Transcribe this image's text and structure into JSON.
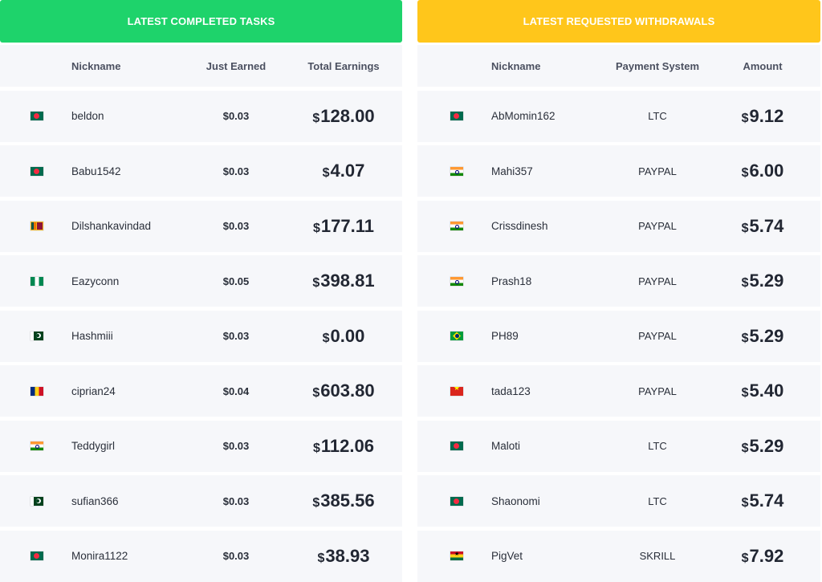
{
  "tasks": {
    "title": "LATEST COMPLETED TASKS",
    "columns": {
      "nickname": "Nickname",
      "just_earned": "Just Earned",
      "total": "Total Earnings"
    },
    "rows": [
      {
        "flag": "bd",
        "nickname": "beldon",
        "just_earned": "$0.03",
        "currency": "$",
        "total": "128.00"
      },
      {
        "flag": "bd",
        "nickname": "Babu1542",
        "just_earned": "$0.03",
        "currency": "$",
        "total": "4.07"
      },
      {
        "flag": "lk",
        "nickname": "Dilshankavindad",
        "just_earned": "$0.03",
        "currency": "$",
        "total": "177.11"
      },
      {
        "flag": "ng",
        "nickname": "Eazyconn",
        "just_earned": "$0.05",
        "currency": "$",
        "total": "398.81"
      },
      {
        "flag": "pk",
        "nickname": "Hashmiii",
        "just_earned": "$0.03",
        "currency": "$",
        "total": "0.00"
      },
      {
        "flag": "ro",
        "nickname": "ciprian24",
        "just_earned": "$0.04",
        "currency": "$",
        "total": "603.80"
      },
      {
        "flag": "in",
        "nickname": "Teddygirl",
        "just_earned": "$0.03",
        "currency": "$",
        "total": "112.06"
      },
      {
        "flag": "pk",
        "nickname": "sufian366",
        "just_earned": "$0.03",
        "currency": "$",
        "total": "385.56"
      },
      {
        "flag": "bd",
        "nickname": "Monira1122",
        "just_earned": "$0.03",
        "currency": "$",
        "total": "38.93"
      }
    ]
  },
  "withdrawals": {
    "title": "LATEST REQUESTED WITHDRAWALS",
    "columns": {
      "nickname": "Nickname",
      "payment_system": "Payment System",
      "amount": "Amount"
    },
    "rows": [
      {
        "flag": "bd",
        "nickname": "AbMomin162",
        "payment_system": "LTC",
        "currency": "$",
        "amount": "9.12"
      },
      {
        "flag": "in",
        "nickname": "Mahi357",
        "payment_system": "PAYPAL",
        "currency": "$",
        "amount": "6.00"
      },
      {
        "flag": "in",
        "nickname": "Crissdinesh",
        "payment_system": "PAYPAL",
        "currency": "$",
        "amount": "5.74"
      },
      {
        "flag": "in",
        "nickname": "Prash18",
        "payment_system": "PAYPAL",
        "currency": "$",
        "amount": "5.29"
      },
      {
        "flag": "br",
        "nickname": "PH89",
        "payment_system": "PAYPAL",
        "currency": "$",
        "amount": "5.29"
      },
      {
        "flag": "vn",
        "nickname": "tada123",
        "payment_system": "PAYPAL",
        "currency": "$",
        "amount": "5.40"
      },
      {
        "flag": "bd",
        "nickname": "Maloti",
        "payment_system": "LTC",
        "currency": "$",
        "amount": "5.29"
      },
      {
        "flag": "bd",
        "nickname": "Shaonomi",
        "payment_system": "LTC",
        "currency": "$",
        "amount": "5.74"
      },
      {
        "flag": "gh",
        "nickname": "PigVet",
        "payment_system": "SKRILL",
        "currency": "$",
        "amount": "7.92"
      }
    ]
  },
  "colors": {
    "tasks_banner": "#1ed36b",
    "withdrawals_banner": "#ffc61b",
    "row_bg": "#f6f7fa"
  }
}
